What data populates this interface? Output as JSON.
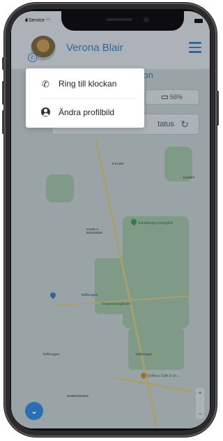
{
  "status_bar": {
    "carrier": "Service",
    "signal_icon": "signal-bars-icon",
    "wifi_icon": "wifi-icon",
    "battery_icon": "battery-icon"
  },
  "header": {
    "user_name": "Verona Blair",
    "menu_icon": "hamburger-menu-icon",
    "avatar_badge_icon": "phone-badge-icon"
  },
  "panel": {
    "title_fragment": "ition",
    "battery_level": "56%",
    "status_fragment": "tatus"
  },
  "dropdown": {
    "items": [
      {
        "label": "Ring till klockan",
        "icon": "phone-icon"
      },
      {
        "label": "Ändra profilbild",
        "icon": "user-circle-icon"
      }
    ]
  },
  "map": {
    "labels": [
      "DALEN",
      "KARRT",
      "GAMLA ENSKEDE",
      "Sandsborgs kyrkogård",
      "Tallkrogen",
      "Skogskyrkogården",
      "Tallkrogen",
      "Tallkrogen",
      "SUBRÄNGEN",
      "Quikbuy Cafe & Sn..."
    ]
  },
  "fab": {
    "icon": "chevron-down-icon"
  },
  "colors": {
    "accent": "#3a86d0",
    "overlay": "#263442",
    "fab": "#2a6fb3"
  }
}
